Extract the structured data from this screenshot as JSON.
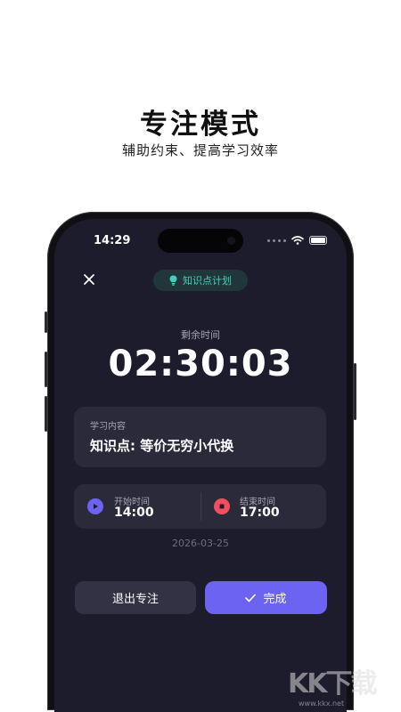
{
  "promo": {
    "headline": "专注模式",
    "subline": "辅助约束、提高学习效率"
  },
  "status_bar": {
    "time": "14:29"
  },
  "header": {
    "close_icon": "close-icon",
    "plan_badge": {
      "icon": "bulb-icon",
      "label": "知识点计划",
      "color": "#3fd1bb"
    }
  },
  "timer": {
    "label": "剩余时间",
    "value": "02:30:03"
  },
  "study_content": {
    "label": "学习内容",
    "value": "知识点: 等价无穷小代换"
  },
  "schedule": {
    "start": {
      "icon": "play-icon",
      "label": "开始时间",
      "value": "14:00",
      "color": "#6d63f2"
    },
    "end": {
      "icon": "stop-icon",
      "label": "结束时间",
      "value": "17:00",
      "color": "#f04f5e"
    }
  },
  "date": "2026-03-25",
  "actions": {
    "exit_label": "退出专注",
    "done_label": "完成",
    "done_icon": "check-icon",
    "accent": "#6d63f2"
  },
  "watermark": {
    "logo_text": "KK下载",
    "url": "www.kkx.net"
  }
}
